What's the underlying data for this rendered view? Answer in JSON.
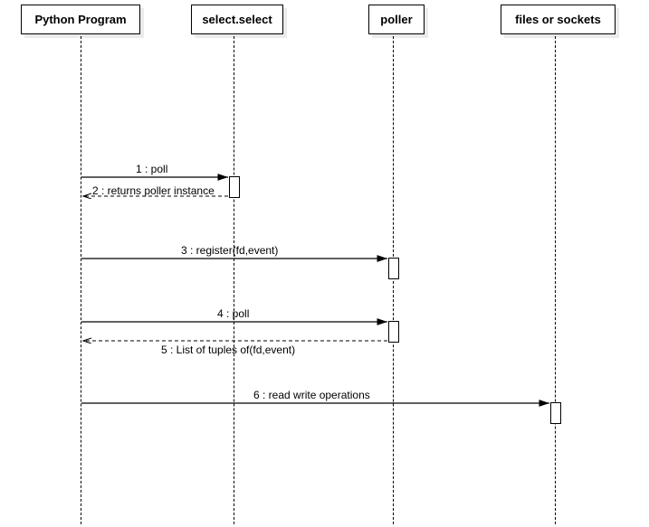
{
  "participants": {
    "p1": "Python Program",
    "p2": "select.select",
    "p3": "poller",
    "p4": "files or sockets"
  },
  "messages": {
    "m1": "1 : poll",
    "m2": "2 : returns poller instance",
    "m3": "3 : register(fd,event)",
    "m4": "4 : poll",
    "m5": "5 : List of tuples of(fd,event)",
    "m6": "6 : read write operations"
  },
  "chart_data": {
    "type": "sequence-diagram",
    "participants": [
      "Python Program",
      "select.select",
      "poller",
      "files or sockets"
    ],
    "messages": [
      {
        "n": 1,
        "from": "Python Program",
        "to": "select.select",
        "text": "poll",
        "return": false
      },
      {
        "n": 2,
        "from": "select.select",
        "to": "Python Program",
        "text": "returns poller instance",
        "return": true
      },
      {
        "n": 3,
        "from": "Python Program",
        "to": "poller",
        "text": "register(fd,event)",
        "return": false
      },
      {
        "n": 4,
        "from": "Python Program",
        "to": "poller",
        "text": "poll",
        "return": false
      },
      {
        "n": 5,
        "from": "poller",
        "to": "Python Program",
        "text": "List of tuples of(fd,event)",
        "return": true
      },
      {
        "n": 6,
        "from": "Python Program",
        "to": "files or sockets",
        "text": "read write operations",
        "return": false
      }
    ]
  }
}
